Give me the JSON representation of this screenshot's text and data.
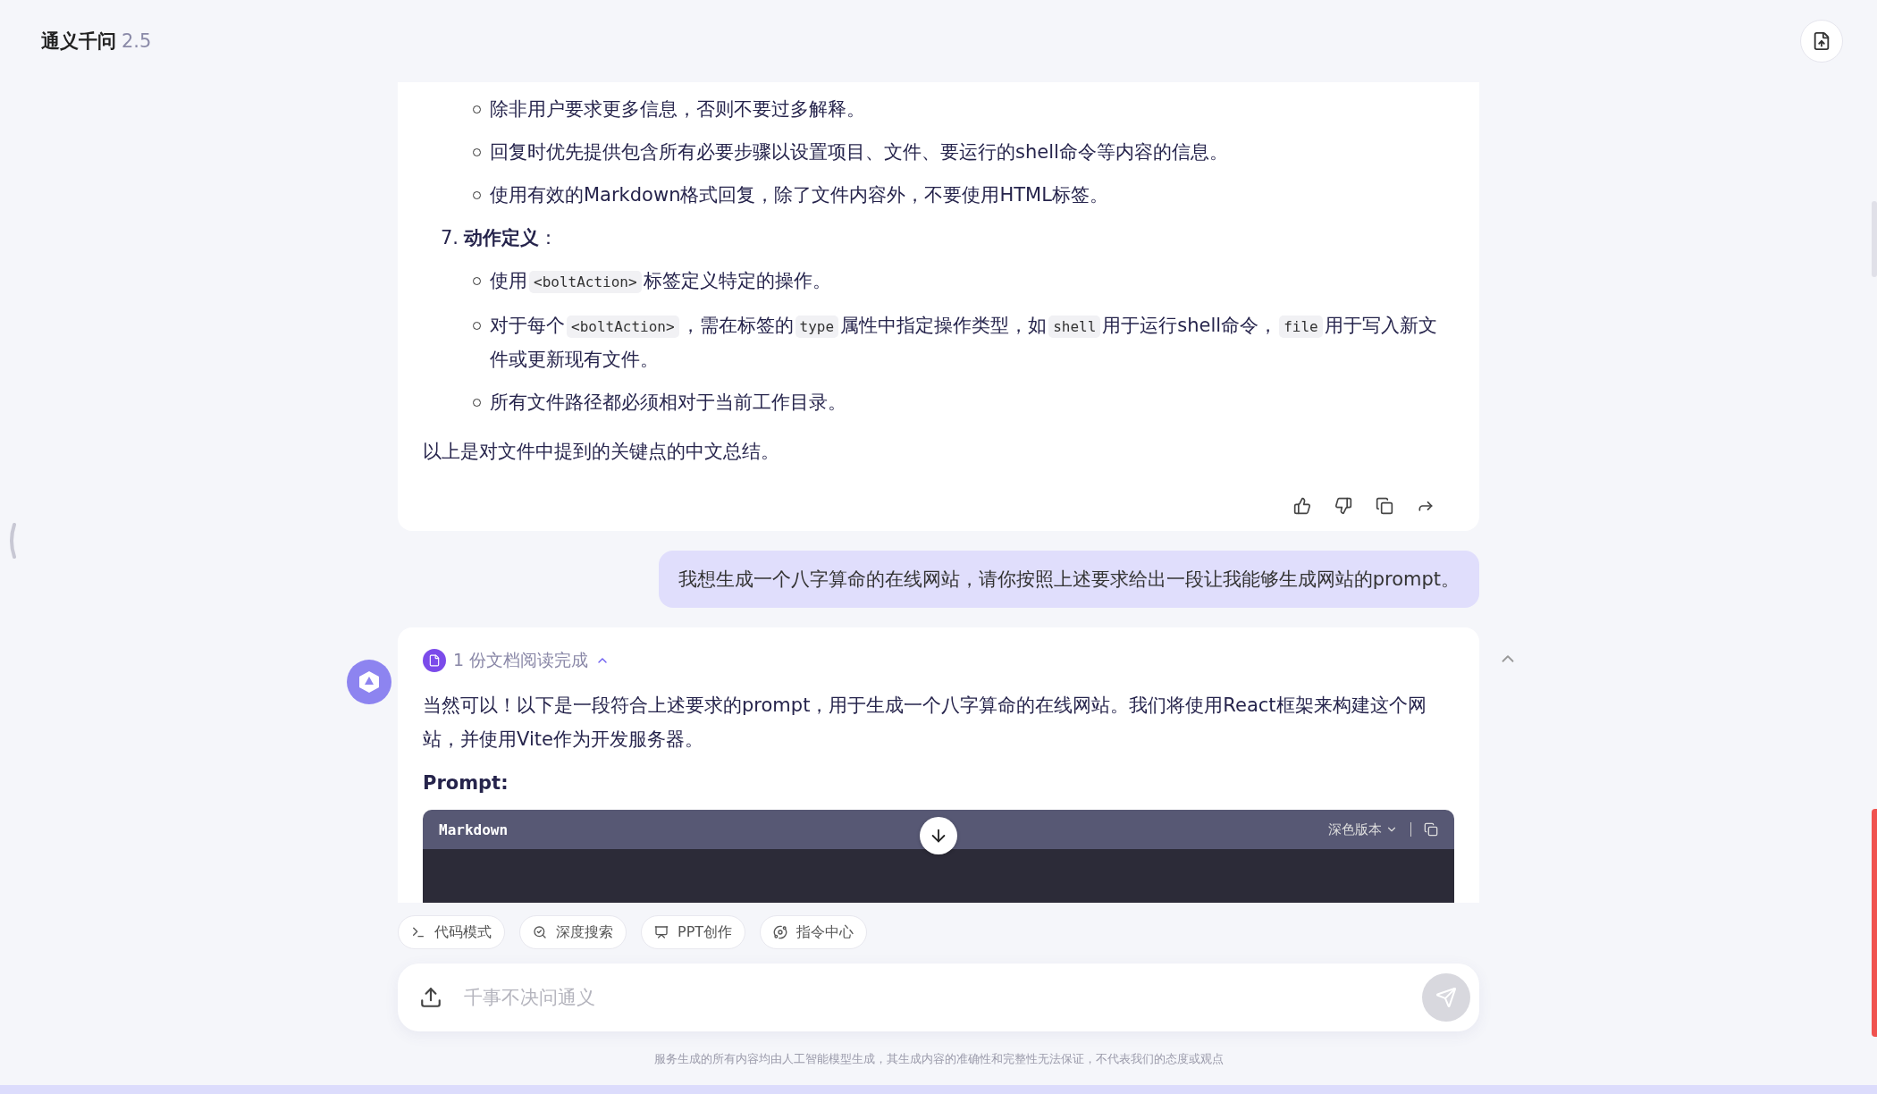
{
  "header": {
    "title": "通义千问",
    "version": "2.5"
  },
  "answer_1": {
    "sub_bullets": [
      "除非用户要求更多信息，否则不要过多解释。",
      "回复时优先提供包含所有必要步骤以设置项目、文件、要运行的shell命令等内容的信息。",
      "使用有效的Markdown格式回复，除了文件内容外，不要使用HTML标签。"
    ],
    "numbered": [
      {
        "number": "7.",
        "title": "**动作定义**：",
        "bullets": [
          [
            {
              "kind": "text",
              "text": "使用"
            },
            {
              "kind": "code",
              "text": "<boltAction>"
            },
            {
              "kind": "text",
              "text": "标签定义特定的操作。"
            }
          ],
          [
            {
              "kind": "text",
              "text": "对于每个"
            },
            {
              "kind": "code",
              "text": "<boltAction>"
            },
            {
              "kind": "text",
              "text": "，需在标签的"
            },
            {
              "kind": "code",
              "text": "type"
            },
            {
              "kind": "text",
              "text": "属性中指定操作类型，如"
            },
            {
              "kind": "code",
              "text": "shell"
            },
            {
              "kind": "text",
              "text": "用于运行shell命令，"
            },
            {
              "kind": "code",
              "text": "file"
            },
            {
              "kind": "text",
              "text": "用于写入新文件或更新现有文件。"
            }
          ],
          [
            {
              "kind": "text",
              "text": "所有文件路径都必须相对于当前工作目录。"
            }
          ]
        ]
      }
    ],
    "closing": "以上是对文件中提到的关键点的中文总结。"
  },
  "user_message": "我想生成一个八字算命的在线网站，请你按照上述要求给出一段让我能够生成网站的prompt。",
  "answer_2": {
    "doc_status": {
      "label": "1 份文档阅读完成",
      "expanded": true
    },
    "paragraph": "当然可以！以下是一段符合上述要求的prompt，用于生成一个八字算命的在线网站。我们将使用React框架来构建这个网站，并使用Vite作为开发服务器。",
    "heading": "Prompt:",
    "code_block": {
      "language": "Markdown",
      "theme": "深色版本"
    }
  },
  "toolbar": [
    {
      "label": "代码模式",
      "kind": "terminal"
    },
    {
      "label": "深度搜索",
      "kind": "search"
    },
    {
      "label": "PPT创作",
      "kind": "presentation"
    },
    {
      "label": "指令中心",
      "kind": "commands"
    }
  ],
  "input": {
    "placeholder": "千事不决问通义",
    "send_disabled": true
  },
  "footer": "服务生成的所有内容均由人工智能模型生成，其生成内容的准确性和完整性无法保证，不代表我们的态度或观点"
}
